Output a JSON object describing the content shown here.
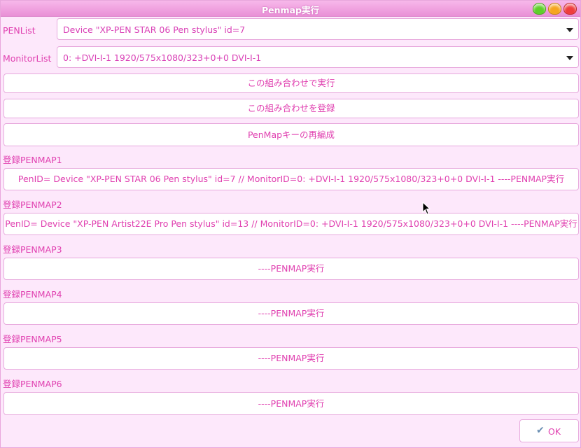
{
  "window": {
    "title": "Penmap実行"
  },
  "pen_list": {
    "label": "PENList",
    "value": "Device \"XP-PEN STAR 06 Pen stylus\" id=7"
  },
  "monitor_list": {
    "label": "MonitorList",
    "value": "0: +DVI-I-1 1920/575x1080/323+0+0  DVI-I-1"
  },
  "actions": {
    "run_combo": "この組み合わせで実行",
    "register_combo": "この組み合わせを登録",
    "rebuild_keys": "PenMapキーの再編成"
  },
  "registered": [
    {
      "label": "登録PENMAP1",
      "button": "PenID= Device \"XP-PEN STAR 06 Pen stylus\" id=7 // MonitorID=0: +DVI-I-1 1920/575x1080/323+0+0 DVI-I-1 ----PENMAP実行"
    },
    {
      "label": "登録PENMAP2",
      "button": "PenID= Device \"XP-PEN Artist22E Pro Pen stylus\" id=13 // MonitorID=0: +DVI-I-1 1920/575x1080/323+0+0 DVI-I-1 ----PENMAP実行"
    },
    {
      "label": "登録PENMAP3",
      "button": "----PENMAP実行"
    },
    {
      "label": "登録PENMAP4",
      "button": "----PENMAP実行"
    },
    {
      "label": "登録PENMAP5",
      "button": "----PENMAP実行"
    },
    {
      "label": "登録PENMAP6",
      "button": "----PENMAP実行"
    }
  ],
  "ok": {
    "label": "OK",
    "icon": "check-icon"
  },
  "colors": {
    "accent": "#e040b0",
    "title_bar": "#f0a6e2",
    "background": "#fde8fb"
  }
}
